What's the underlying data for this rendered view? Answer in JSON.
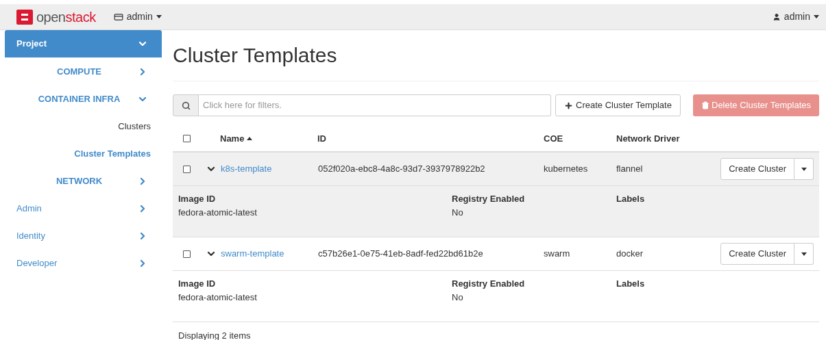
{
  "navbar": {
    "brand": {
      "prefix": "open",
      "suffix": "stack"
    },
    "project_menu": "admin",
    "user_menu": "admin"
  },
  "sidebar": {
    "items": [
      {
        "label": "Project",
        "kind": "group",
        "expanded": true,
        "selected": true,
        "children": [
          {
            "label": "COMPUTE",
            "kind": "group",
            "expanded": false,
            "selected": false
          },
          {
            "label": "CONTAINER INFRA",
            "kind": "group",
            "expanded": true,
            "selected": false,
            "children": [
              {
                "label": "Clusters",
                "kind": "link",
                "selected": false
              },
              {
                "label": "Cluster Templates",
                "kind": "link",
                "selected": true
              }
            ]
          },
          {
            "label": "NETWORK",
            "kind": "group",
            "expanded": false,
            "selected": false
          }
        ]
      },
      {
        "label": "Admin",
        "kind": "group",
        "expanded": false,
        "selected": false
      },
      {
        "label": "Identity",
        "kind": "group",
        "expanded": false,
        "selected": false
      },
      {
        "label": "Developer",
        "kind": "group",
        "expanded": false,
        "selected": false
      }
    ]
  },
  "page_title": "Cluster Templates",
  "toolbar": {
    "filter": {
      "placeholder": "Click here for filters."
    },
    "create_button": {
      "label": "Create Cluster Template",
      "disabled": false
    },
    "delete_button": {
      "label": "Delete Cluster Templates",
      "disabled": true
    }
  },
  "table": {
    "select_all": {
      "checked": false
    },
    "columns": [
      {
        "label": "Name",
        "sorted_ascending": true
      },
      {
        "label": "ID"
      },
      {
        "label": "COE"
      },
      {
        "label": "Network Driver"
      }
    ],
    "rows": [
      {
        "checked": false,
        "expanded": true,
        "highlighted": true,
        "name": "k8s-template",
        "id": "052f020a-ebc8-4a8c-93d7-3937978922b2",
        "coe": "kubernetes",
        "network_driver": "flannel",
        "action": "Create Cluster",
        "details": [
          {
            "label": "Image ID",
            "value": "fedora-atomic-latest"
          },
          {
            "label": "Registry Enabled",
            "value": "No"
          },
          {
            "label": "Labels"
          }
        ]
      },
      {
        "checked": false,
        "expanded": true,
        "highlighted": false,
        "name": "swarm-template",
        "id": "c57b26e1-0e75-41eb-8adf-fed22bd61b2e",
        "coe": "swarm",
        "network_driver": "docker",
        "action": "Create Cluster",
        "details": [
          {
            "label": "Image ID",
            "value": "fedora-atomic-latest"
          },
          {
            "label": "Registry Enabled",
            "value": "No"
          },
          {
            "label": "Labels"
          }
        ]
      }
    ],
    "footer": "Displaying 2 items"
  }
}
